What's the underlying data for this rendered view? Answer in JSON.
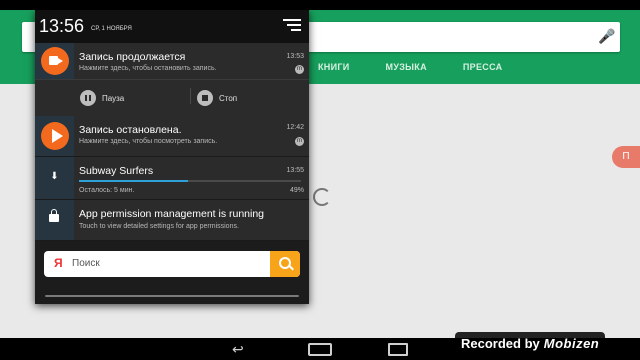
{
  "background_app": {
    "tabs": [
      "КНИГИ",
      "МУЗЫКА",
      "ПРЕССА"
    ],
    "side_badge": "П"
  },
  "shade": {
    "time": "13:56",
    "date": "СР, 1 НОЯБРЯ",
    "notifications": [
      {
        "title": "Запись продолжается",
        "subtitle": "Нажмите здесь, чтобы остановить запись.",
        "time": "13:53",
        "actions": [
          {
            "label": "Пауза",
            "icon": "pause-icon"
          },
          {
            "label": "Стоп",
            "icon": "stop-icon"
          }
        ]
      },
      {
        "title": "Запись остановлена.",
        "subtitle": "Нажмите здесь, чтобы посмотреть запись.",
        "time": "12:42"
      },
      {
        "title": "Subway Surfers",
        "subtitle": "Осталось: 5 мин.",
        "time": "13:55",
        "percent": "49%",
        "progress": 0.49
      },
      {
        "title": "App permission management is running",
        "subtitle": "Touch to view detailed settings for app permissions."
      }
    ],
    "search": {
      "logo": "Я",
      "placeholder": "Поиск"
    }
  },
  "watermark": {
    "text": "Recorded by",
    "logo": "Mobizen"
  },
  "colors": {
    "accent_orange": "#f36a1e",
    "progress_blue": "#2f9fd7",
    "play_store_green": "#17a05d",
    "search_button": "#f8a41a"
  }
}
